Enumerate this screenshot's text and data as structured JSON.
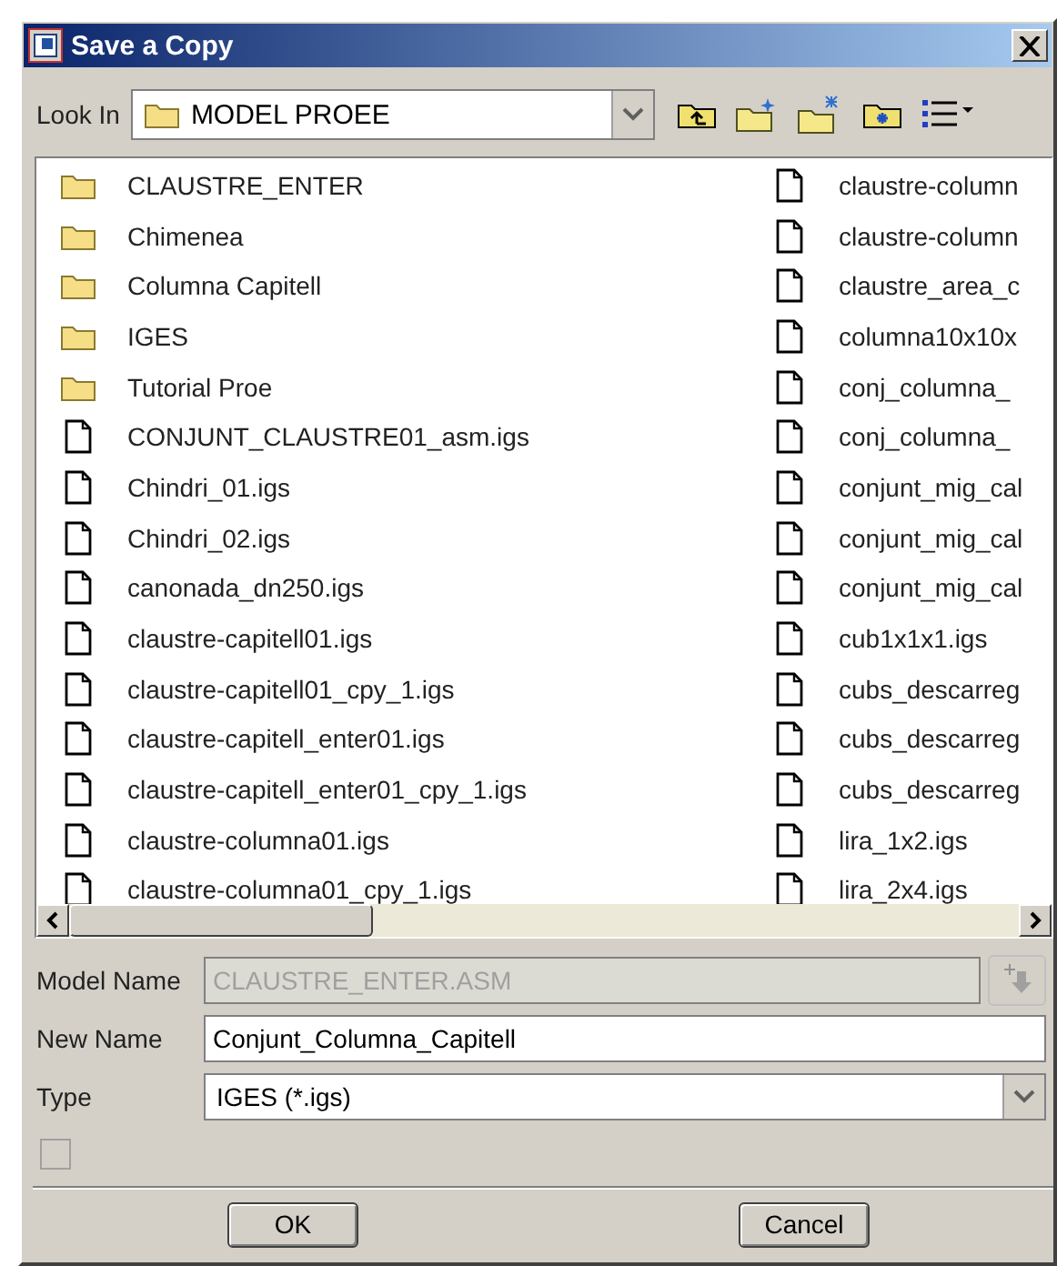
{
  "window": {
    "title": "Save a Copy"
  },
  "look_in": {
    "label": "Look In",
    "value": "MODEL PROEE"
  },
  "files": {
    "columns": [
      [
        {
          "name": "CLAUSTRE_ENTER",
          "kind": "folder"
        },
        {
          "name": "Chimenea",
          "kind": "folder"
        },
        {
          "name": "Columna Capitell",
          "kind": "folder"
        },
        {
          "name": "IGES",
          "kind": "folder"
        },
        {
          "name": "Tutorial Proe",
          "kind": "folder"
        },
        {
          "name": "CONJUNT_CLAUSTRE01_asm.igs",
          "kind": "file"
        },
        {
          "name": "Chindri_01.igs",
          "kind": "file"
        },
        {
          "name": "Chindri_02.igs",
          "kind": "file"
        },
        {
          "name": "canonada_dn250.igs",
          "kind": "file"
        },
        {
          "name": "claustre-capitell01.igs",
          "kind": "file"
        },
        {
          "name": "claustre-capitell01_cpy_1.igs",
          "kind": "file"
        },
        {
          "name": "claustre-capitell_enter01.igs",
          "kind": "file"
        },
        {
          "name": "claustre-capitell_enter01_cpy_1.igs",
          "kind": "file"
        },
        {
          "name": "claustre-columna01.igs",
          "kind": "file"
        },
        {
          "name": "claustre-columna01_cpy_1.igs",
          "kind": "file"
        }
      ],
      [
        {
          "name": "claustre-column",
          "kind": "file"
        },
        {
          "name": "claustre-column",
          "kind": "file"
        },
        {
          "name": "claustre_area_c",
          "kind": "file"
        },
        {
          "name": "columna10x10x",
          "kind": "file"
        },
        {
          "name": "conj_columna_",
          "kind": "file"
        },
        {
          "name": "conj_columna_",
          "kind": "file"
        },
        {
          "name": "conjunt_mig_cal",
          "kind": "file"
        },
        {
          "name": "conjunt_mig_cal",
          "kind": "file"
        },
        {
          "name": "conjunt_mig_cal",
          "kind": "file"
        },
        {
          "name": "cub1x1x1.igs",
          "kind": "file"
        },
        {
          "name": "cubs_descarreg",
          "kind": "file"
        },
        {
          "name": "cubs_descarreg",
          "kind": "file"
        },
        {
          "name": "cubs_descarreg",
          "kind": "file"
        },
        {
          "name": "lira_1x2.igs",
          "kind": "file"
        },
        {
          "name": "lira_2x4.igs",
          "kind": "file"
        }
      ]
    ]
  },
  "model_name": {
    "label": "Model Name",
    "value": "CLAUSTRE_ENTER.ASM",
    "disabled": true
  },
  "new_name": {
    "label": "New Name",
    "value": "Conjunt_Columna_Capitell"
  },
  "type": {
    "label": "Type",
    "value": "IGES (*.igs)"
  },
  "checkbox": {
    "checked": false,
    "disabled": true
  },
  "buttons": [
    "OK",
    "Cancel"
  ]
}
